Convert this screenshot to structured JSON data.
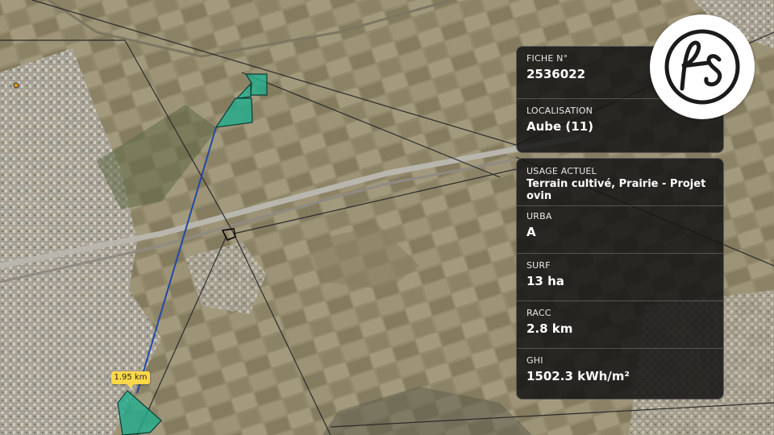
{
  "card_top": {
    "fiche": {
      "label": "FICHE N°",
      "value": "2536022"
    },
    "localisation": {
      "label": "LOCALISATION",
      "value": "Aube (11)"
    }
  },
  "card_main": {
    "usage": {
      "label": "USAGE ACTUEL",
      "value": "Terrain cultivé, Prairie - Projet ovin"
    },
    "urba": {
      "label": "URBA",
      "value": "A"
    },
    "surf": {
      "label": "SURF",
      "value": "13 ha"
    },
    "racc": {
      "label": "RACC",
      "value": "2.8 km"
    },
    "ghi": {
      "label": "GHI",
      "value": "1502.3 kWh/m²"
    }
  },
  "map": {
    "distance_label": "1.95 km",
    "parcel_color": "#1fae8f",
    "route_color": "#1f4aa8"
  },
  "logo": {
    "text": "fs"
  }
}
